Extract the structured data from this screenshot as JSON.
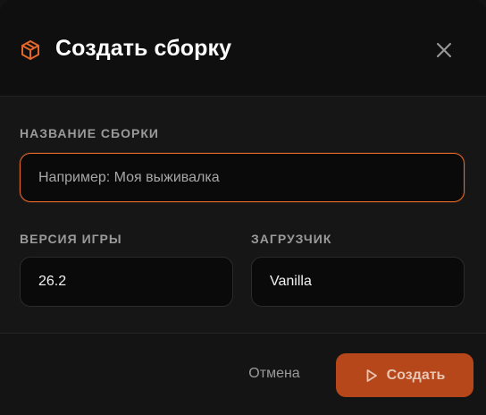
{
  "dialog": {
    "title": "Создать сборку",
    "title_icon": "cube-icon",
    "close_icon": "close-icon"
  },
  "form": {
    "name": {
      "label": "НАЗВАНИЕ СБОРКИ",
      "placeholder": "Например: Моя выживалка",
      "value": ""
    },
    "game_version": {
      "label": "ВЕРСИЯ ИГРЫ",
      "value": "26.2"
    },
    "loader": {
      "label": "ЗАГРУЗЧИК",
      "value": "Vanilla"
    }
  },
  "footer": {
    "cancel_label": "Отмена",
    "create_label": "Создать",
    "create_icon": "play-icon"
  },
  "colors": {
    "accent": "#e3672a",
    "primary_button": "#b5471a",
    "background": "#161616",
    "field_background": "#0a0a0a"
  }
}
